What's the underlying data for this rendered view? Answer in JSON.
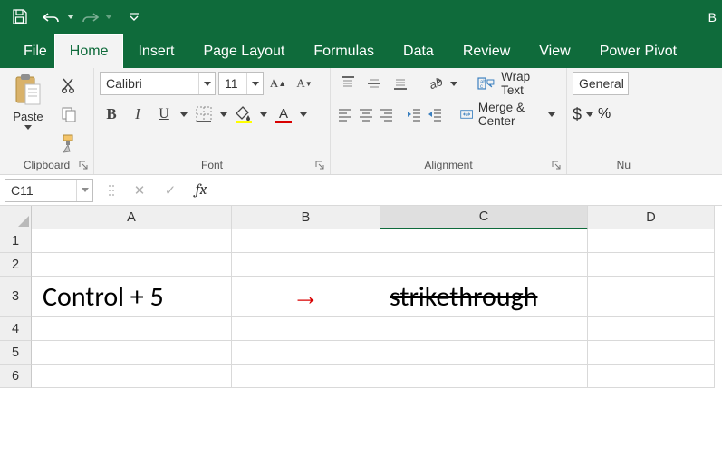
{
  "titlebar": {
    "document_right": "B"
  },
  "tabs": {
    "file": "File",
    "home": "Home",
    "insert": "Insert",
    "page_layout": "Page Layout",
    "formulas": "Formulas",
    "data": "Data",
    "review": "Review",
    "view": "View",
    "power_pivot": "Power Pivot"
  },
  "ribbon": {
    "clipboard": {
      "paste": "Paste",
      "caption": "Clipboard"
    },
    "font": {
      "name": "Calibri",
      "size": "11",
      "bold": "B",
      "italic": "I",
      "underline": "U",
      "caption": "Font"
    },
    "alignment": {
      "wrap": "Wrap Text",
      "merge": "Merge & Center",
      "caption": "Alignment"
    },
    "number": {
      "format": "General",
      "dollar": "$",
      "pct": "%",
      "caption": "Nu"
    }
  },
  "formula_bar": {
    "namebox": "C11",
    "fx_label": "fx"
  },
  "grid": {
    "cols": [
      "A",
      "B",
      "C",
      "D"
    ],
    "rows": [
      "1",
      "2",
      "3",
      "4",
      "5",
      "6"
    ],
    "a3": "Control + 5",
    "b3": "→",
    "c3": "strikethrough",
    "active_col": "C"
  }
}
